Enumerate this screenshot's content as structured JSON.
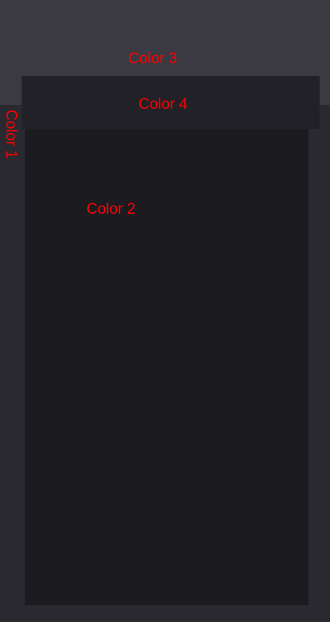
{
  "colors": {
    "outer_background": "#2a2930",
    "top_region": "#3b3941",
    "header_bar": "#222127",
    "content_panel": "#1c1b20",
    "label_text": "#ff0000"
  },
  "labels": {
    "color_1": "Color 1",
    "color_2": "Color 2",
    "color_3": "Color 3",
    "color_4": "Color 4"
  }
}
